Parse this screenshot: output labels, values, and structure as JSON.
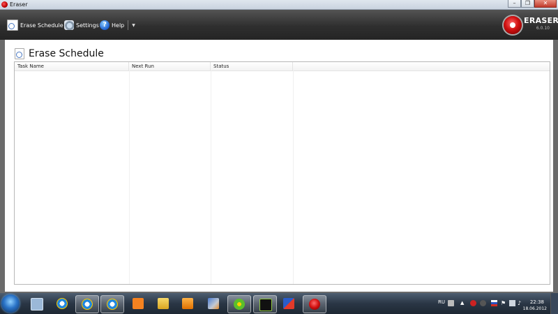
{
  "window": {
    "title": "Eraser",
    "minimize_glyph": "–",
    "maximize_glyph": "❐",
    "close_glyph": "✕"
  },
  "toolbar": {
    "erase_schedule_label": "Erase Schedule",
    "settings_label": "Settings",
    "help_label": "Help",
    "help_glyph": "?"
  },
  "brand": {
    "name": "ERASER",
    "version": "6.0.10"
  },
  "page": {
    "title": "Erase Schedule"
  },
  "table": {
    "columns": [
      "Task Name",
      "Next Run",
      "Status"
    ],
    "rows": []
  },
  "taskbar": {
    "apps": [
      "windows-explorer",
      "internet-explorer",
      "internet-explorer",
      "internet-explorer",
      "odnoklassniki",
      "file-explorer",
      "media-player",
      "installer",
      "icq",
      "asrock",
      "app-launcher",
      "eraser"
    ],
    "language": "RU",
    "time": "22:38",
    "date": "18.06.2012"
  },
  "colors": {
    "toolbar_bg": "#2f2f2f",
    "brand_red": "#d01010",
    "taskbar_bg": "#2a3645"
  }
}
